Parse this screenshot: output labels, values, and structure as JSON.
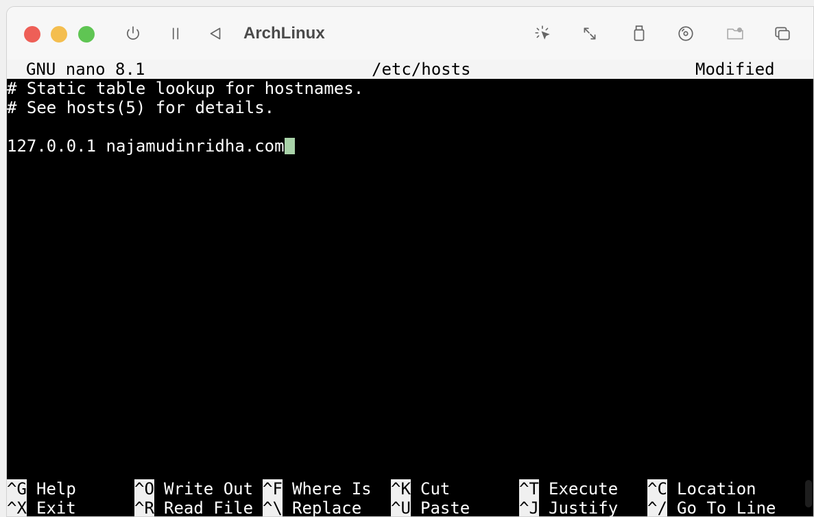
{
  "window": {
    "title": "ArchLinux",
    "traffic_lights": {
      "close": "#ee5f57",
      "minimize": "#f4be4f",
      "maximize": "#5fc553"
    },
    "toolbar_icons": [
      "power-icon",
      "pause-icon",
      "back-triangle-icon",
      "cursor-capture-icon",
      "resize-arrows-icon",
      "usb-icon",
      "disc-icon",
      "shared-folder-icon",
      "windows-icon"
    ]
  },
  "nano": {
    "status": {
      "app": "GNU nano 8.1",
      "file": "/etc/hosts",
      "state": "Modified"
    },
    "lines": [
      "# Static table lookup for hostnames.",
      "# See hosts(5) for details.",
      "",
      "127.0.0.1 najamudinridha.com"
    ],
    "shortcuts": {
      "row1": [
        {
          "key": "^G",
          "label": "Help"
        },
        {
          "key": "^O",
          "label": "Write Out"
        },
        {
          "key": "^F",
          "label": "Where Is"
        },
        {
          "key": "^K",
          "label": "Cut"
        },
        {
          "key": "^T",
          "label": "Execute"
        },
        {
          "key": "^C",
          "label": "Location"
        }
      ],
      "row2": [
        {
          "key": "^X",
          "label": "Exit"
        },
        {
          "key": "^R",
          "label": "Read File"
        },
        {
          "key": "^\\",
          "label": "Replace"
        },
        {
          "key": "^U",
          "label": "Paste"
        },
        {
          "key": "^J",
          "label": "Justify"
        },
        {
          "key": "^/",
          "label": "Go To Line"
        }
      ]
    },
    "cursor_color": "#a9d3a9"
  }
}
